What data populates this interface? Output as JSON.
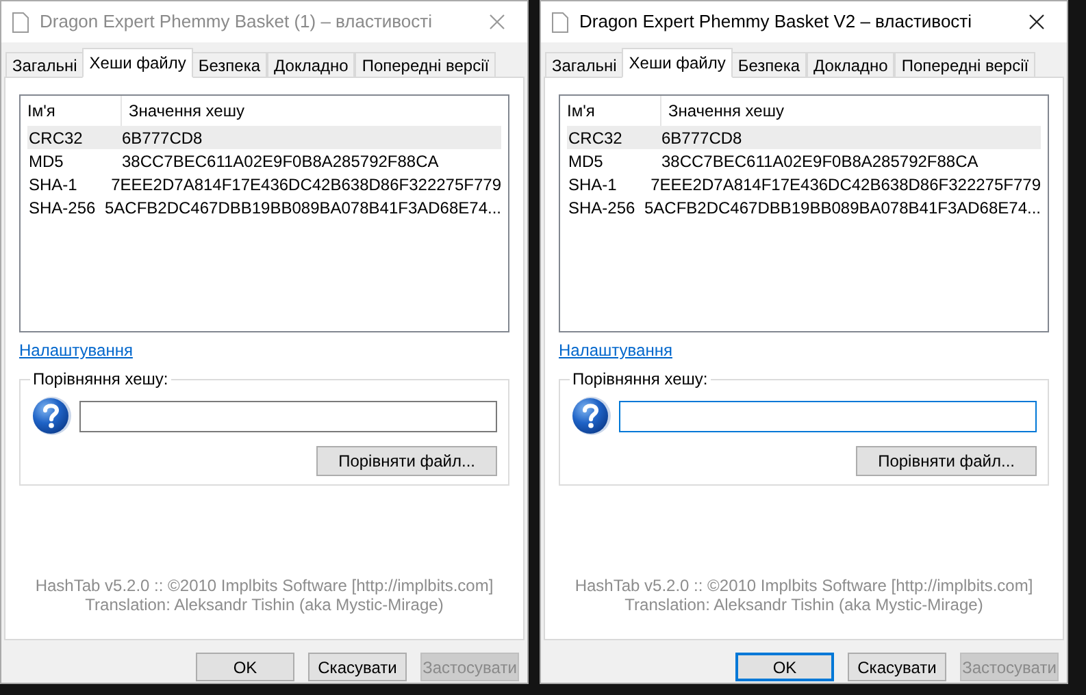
{
  "windows": [
    {
      "title": "Dragon Expert Phemmy Basket (1) – властивості",
      "active": false,
      "tabs": [
        {
          "label": "Загальні",
          "selected": false
        },
        {
          "label": "Хеши файлу",
          "selected": true
        },
        {
          "label": "Безпека",
          "selected": false
        },
        {
          "label": "Докладно",
          "selected": false
        },
        {
          "label": "Попередні версії",
          "selected": false
        }
      ],
      "columns": [
        "Ім'я",
        "Значення хешу"
      ],
      "rows": [
        {
          "name": "CRC32",
          "value": "6B777CD8",
          "selected": true
        },
        {
          "name": "MD5",
          "value": "38CC7BEC611A02E9F0B8A285792F88CA",
          "selected": false
        },
        {
          "name": "SHA-1",
          "value": "7EEE2D7A814F17E436DC42B638D86F322275F779",
          "selected": false
        },
        {
          "name": "SHA-256",
          "value": "5ACFB2DC467DBB19BB089BA078B41F3AD68E74...",
          "selected": false
        }
      ],
      "settings_link": "Налаштування",
      "compare_group": "Порівняння хешу:",
      "compare_button": "Порівняти файл...",
      "footer": [
        "HashTab v5.2.0 :: ©2010 Implbits Software [http://implbits.com]",
        "Translation: Aleksandr Tishin (aka Mystic-Mirage)"
      ],
      "buttons": [
        {
          "label": "OK",
          "disabled": false
        },
        {
          "label": "Скасувати",
          "disabled": false
        },
        {
          "label": "Застосувати",
          "disabled": true
        }
      ]
    },
    {
      "title": "Dragon Expert Phemmy Basket V2 – властивості",
      "active": true,
      "tabs": [
        {
          "label": "Загальні",
          "selected": false
        },
        {
          "label": "Хеши файлу",
          "selected": true
        },
        {
          "label": "Безпека",
          "selected": false
        },
        {
          "label": "Докладно",
          "selected": false
        },
        {
          "label": "Попередні версії",
          "selected": false
        }
      ],
      "columns": [
        "Ім'я",
        "Значення хешу"
      ],
      "rows": [
        {
          "name": "CRC32",
          "value": "6B777CD8",
          "selected": true
        },
        {
          "name": "MD5",
          "value": "38CC7BEC611A02E9F0B8A285792F88CA",
          "selected": false
        },
        {
          "name": "SHA-1",
          "value": "7EEE2D7A814F17E436DC42B638D86F322275F779",
          "selected": false
        },
        {
          "name": "SHA-256",
          "value": "5ACFB2DC467DBB19BB089BA078B41F3AD68E74...",
          "selected": false
        }
      ],
      "settings_link": "Налаштування",
      "compare_group": "Порівняння хешу:",
      "compare_button": "Порівняти файл...",
      "footer": [
        "HashTab v5.2.0 :: ©2010 Implbits Software [http://implbits.com]",
        "Translation: Aleksandr Tishin (aka Mystic-Mirage)"
      ],
      "buttons": [
        {
          "label": "OK",
          "disabled": false
        },
        {
          "label": "Скасувати",
          "disabled": false
        },
        {
          "label": "Застосувати",
          "disabled": true
        }
      ]
    }
  ]
}
